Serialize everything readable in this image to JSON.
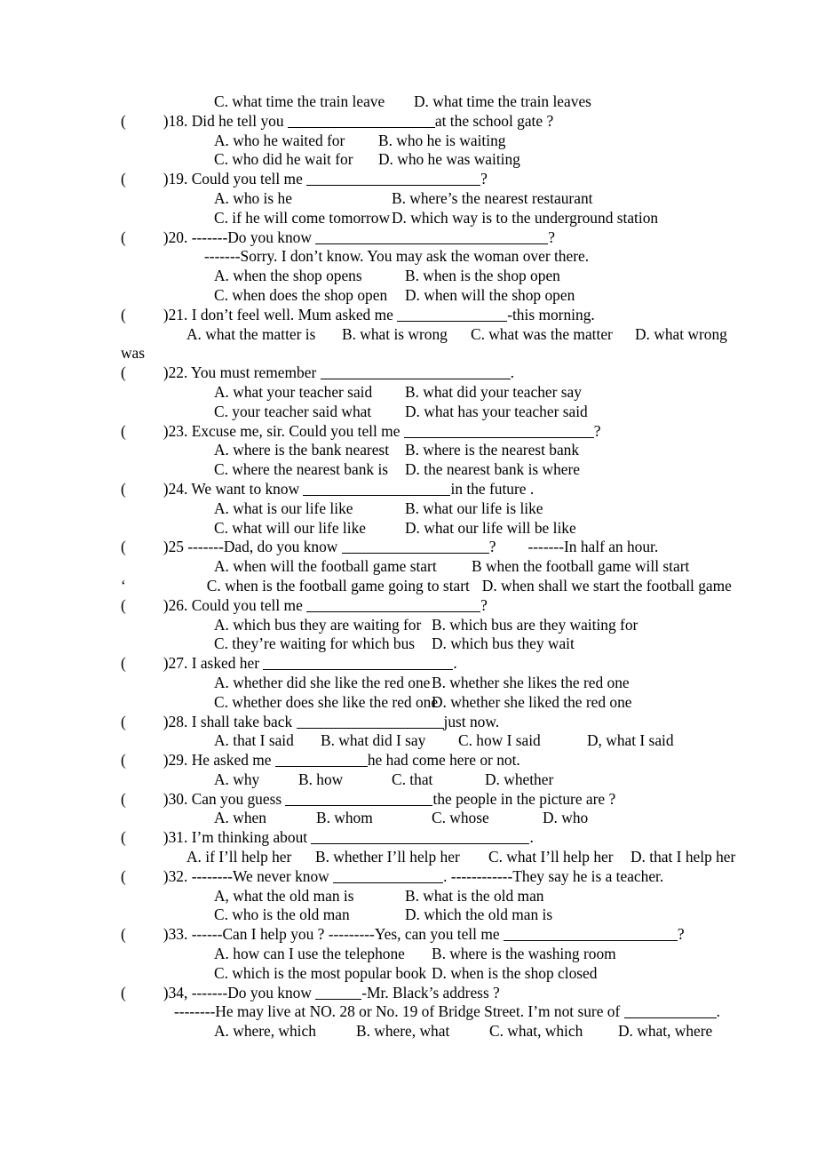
{
  "document": {
    "type": "english-grammar-worksheet",
    "topic": "noun clauses / indirect questions multiple choice",
    "lines": {
      "q17_opts_cd": {
        "c": "C. what time the train leave",
        "d": "D. what time the train leaves"
      },
      "q18": {
        "open": "(",
        "close": ")",
        "num": "18.",
        "stem_before": " Did he tell you ",
        "stem_after": "at the school gate ?",
        "a": "A. who he waited for",
        "b": "B. who he is waiting",
        "c": "C. who did he wait for",
        "d": "D. who he was waiting"
      },
      "q19": {
        "open": "(",
        "close": ")",
        "num": "19.",
        "stem_before": " Could you tell me ",
        "stem_after": "?",
        "a": "A. who is he",
        "b": "B. where’s the nearest restaurant",
        "c": "C. if he will come tomorrow",
        "d": "D. which way is to the underground station"
      },
      "q20": {
        "open": "(",
        "close": ")",
        "num": "20.",
        "stem_before": " -------Do you know ",
        "stem_after": "?",
        "reply": "-------Sorry. I don’t know. You may ask the woman over there.",
        "a": "A. when the shop opens",
        "b": "B. when is the shop open",
        "c": "C. when does the shop open",
        "d": "D. when will the shop open"
      },
      "q21": {
        "open": "(",
        "close": ")",
        "num": "21.",
        "stem_before": " I don’t feel well. Mum asked me ",
        "stem_after": "-this morning.",
        "a": "A. what the matter is",
        "b": "B. what is wrong",
        "c": "C. what was the matter",
        "d": "D. what wrong",
        "wrap": "was"
      },
      "q22": {
        "open": "(",
        "close": ")",
        "num": "22.",
        "stem_before": " You must remember ",
        "stem_after": ".",
        "a": "A. what your teacher said",
        "b": "B. what did your teacher say",
        "c": "C. your teacher said what",
        "d": "D. what has your teacher said"
      },
      "q23": {
        "open": "(",
        "close": ")",
        "num": "23.",
        "stem_before": " Excuse me, sir. Could you tell me ",
        "stem_after": "?",
        "a": "A. where is the bank nearest",
        "b": "B. where is the nearest bank",
        "c": "C. where the nearest bank is",
        "d": "D. the nearest bank is where"
      },
      "q24": {
        "open": "(",
        "close": ")",
        "num": "24.",
        "stem_before": " We want to know ",
        "stem_after": "in the future .",
        "a": "A. what is our life like",
        "b": "B. what our life is like",
        "c": "C. what will our life like",
        "d": "D. what our life will be like"
      },
      "q25": {
        "open": "(",
        "close": ")",
        "num": "25",
        "stem_before": " -------Dad, do you know ",
        "stem_after": "?",
        "stem_tail": "-------In half an hour.",
        "a": "A. when will the football game start",
        "b": "B when the football game will start",
        "c": "C. when is the football game going to start",
        "d": "D. when shall we start the football game",
        "stray_mark": "‘"
      },
      "q26": {
        "open": "(",
        "close": ")",
        "num": "26.",
        "stem_before": " Could you tell me ",
        "stem_after": "?",
        "a": "A. which bus they are waiting for",
        "b": "B. which bus are they waiting for",
        "c": "C. they’re waiting for which bus",
        "d": "D. which bus they wait"
      },
      "q27": {
        "open": "(",
        "close": ")",
        "num": "27.",
        "stem_before": " I asked her ",
        "stem_after": ".",
        "a": "A. whether did she like the red one",
        "b": "B. whether she likes the red one",
        "c": "C. whether does she like the red one",
        "d": "D. whether she liked the red one"
      },
      "q28": {
        "open": "(",
        "close": ")",
        "num": "28.",
        "stem_before": " I shall take back ",
        "stem_after": "just now.",
        "a": "A. that I said",
        "b": "B. what did I say",
        "c": "C. how I said",
        "d": "D, what I said"
      },
      "q29": {
        "open": "(",
        "close": ")",
        "num": "29.",
        "stem_before": " He asked me ",
        "stem_after": "he had come here or not.",
        "a": "A. why",
        "b": "B. how",
        "c": "C. that",
        "d": "D. whether"
      },
      "q30": {
        "open": "(",
        "close": ")",
        "num": "30.",
        "stem_before": " Can you guess ",
        "stem_after": "the people in the picture are ?",
        "a": "A. when",
        "b": "B. whom",
        "c": "C. whose",
        "d": "D. who"
      },
      "q31": {
        "open": "(",
        "close": ")",
        "num": "31.",
        "stem_before": " I’m thinking about ",
        "stem_after": ".",
        "a": "A. if I’ll help her",
        "b": "B. whether I’ll help her",
        "c": "C. what I’ll help her",
        "d": "D. that I help her"
      },
      "q32": {
        "open": "(",
        "close": ")",
        "num": "32.",
        "stem_before": " --------We never know ",
        "stem_after": ". ------------They say he is a teacher.",
        "a": "A, what the old man is",
        "b": "B. what is the old man",
        "c": "C. who is the old man",
        "d": "D. which the old man is"
      },
      "q33": {
        "open": "(",
        "close": ")",
        "num": "33.",
        "stem_before": " ------Can I help you ? ---------Yes, can you tell me ",
        "stem_after": "?",
        "a": "A. how can I use the telephone",
        "b": "B. where is the washing room",
        "c": "C. which is the most popular book",
        "d": "D. when is the shop closed"
      },
      "q34": {
        "open": "(",
        "close": ")",
        "num": "34,",
        "stem_before": " -------Do you know ",
        "stem_after": "-Mr. Black’s address ?",
        "reply_before": "--------He may live at NO. 28 or No. 19 of Bridge Street. I’m not sure of ",
        "reply_after": ".",
        "a": "A. where, which",
        "b": "B. where, what",
        "c": "C. what, which",
        "d": "D. what, where"
      }
    }
  }
}
